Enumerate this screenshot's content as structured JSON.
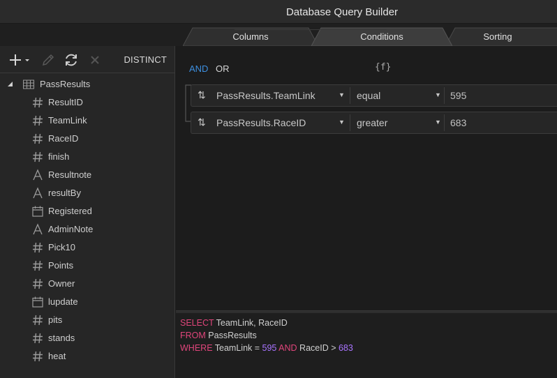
{
  "window": {
    "title": "Database Query Builder"
  },
  "tabs": [
    {
      "label": "Columns",
      "active": false
    },
    {
      "label": "Conditions",
      "active": true
    },
    {
      "label": "Sorting",
      "active": false
    }
  ],
  "toolbar": {
    "distinct_label": "DISTINCT"
  },
  "tree": {
    "table": {
      "name": "PassResults",
      "icon": "table-icon",
      "expanded": true
    },
    "fields": [
      {
        "name": "ResultID",
        "icon": "number-icon"
      },
      {
        "name": "TeamLink",
        "icon": "number-icon"
      },
      {
        "name": "RaceID",
        "icon": "number-icon"
      },
      {
        "name": "finish",
        "icon": "number-icon"
      },
      {
        "name": "Resultnote",
        "icon": "text-icon"
      },
      {
        "name": "resultBy",
        "icon": "text-icon"
      },
      {
        "name": "Registered",
        "icon": "calendar-icon"
      },
      {
        "name": "AdminNote",
        "icon": "text-icon"
      },
      {
        "name": "Pick10",
        "icon": "number-icon"
      },
      {
        "name": "Points",
        "icon": "number-icon"
      },
      {
        "name": "Owner",
        "icon": "number-icon"
      },
      {
        "name": "lupdate",
        "icon": "calendar-icon"
      },
      {
        "name": "pits",
        "icon": "number-icon"
      },
      {
        "name": "stands",
        "icon": "number-icon"
      },
      {
        "name": "heat",
        "icon": "number-icon"
      }
    ]
  },
  "conditions": {
    "and_label": "AND",
    "or_label": "OR",
    "active_conjunction": "AND",
    "function_icon_label": "{f}",
    "rows": [
      {
        "field": "PassResults.TeamLink",
        "operator": "equal",
        "value": "595"
      },
      {
        "field": "PassResults.RaceID",
        "operator": "greater",
        "value": "683"
      }
    ]
  },
  "sql": {
    "line1": {
      "kw": "SELECT",
      "rest": " TeamLink, RaceID"
    },
    "line2": {
      "kw": "FROM",
      "rest": " PassResults"
    },
    "line3": {
      "kw": "WHERE",
      "a": " TeamLink = ",
      "v1": "595",
      "kw2": " AND",
      "b": " RaceID > ",
      "v2": "683"
    }
  },
  "colors": {
    "accent": "#3d8fe0",
    "keyword": "#e0457b",
    "number": "#a974ff"
  }
}
